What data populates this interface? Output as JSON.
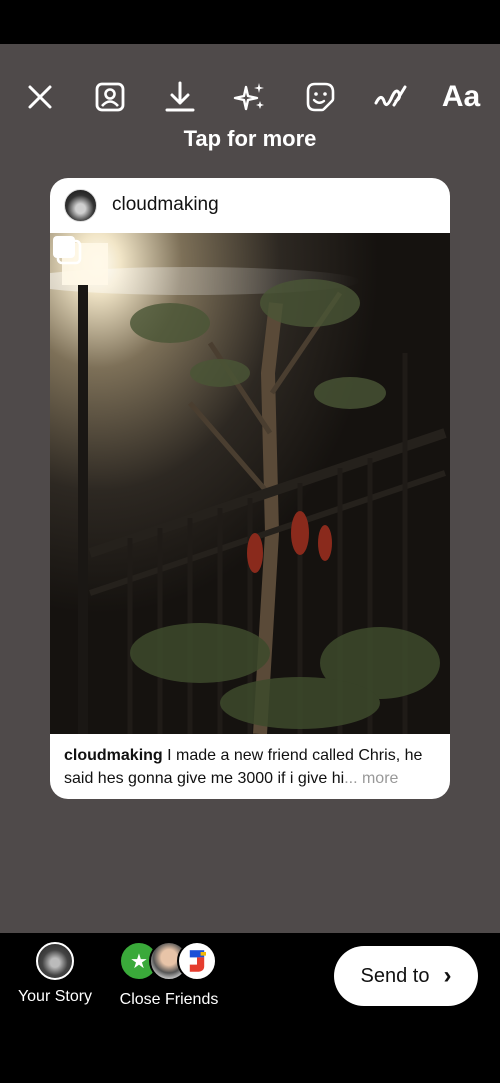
{
  "toolbar": {
    "icons": [
      "close-icon",
      "profile-frame-icon",
      "download-icon",
      "effects-sparkles-icon",
      "sticker-icon",
      "draw-squiggle-icon"
    ],
    "text_tool_label": "Aa"
  },
  "hint": "Tap for more",
  "post": {
    "username": "cloudmaking",
    "caption_user": "cloudmaking",
    "caption_text": " I made a new friend called Chris, he said hes gonna give me 3000 if i give hi",
    "caption_more": "... more"
  },
  "bottom": {
    "your_story_label": "Your Story",
    "close_friends_label": "Close Friends",
    "send_label": "Send to"
  },
  "colors": {
    "background": "#4f4a4a",
    "close_friends_green": "#3aa93a"
  }
}
